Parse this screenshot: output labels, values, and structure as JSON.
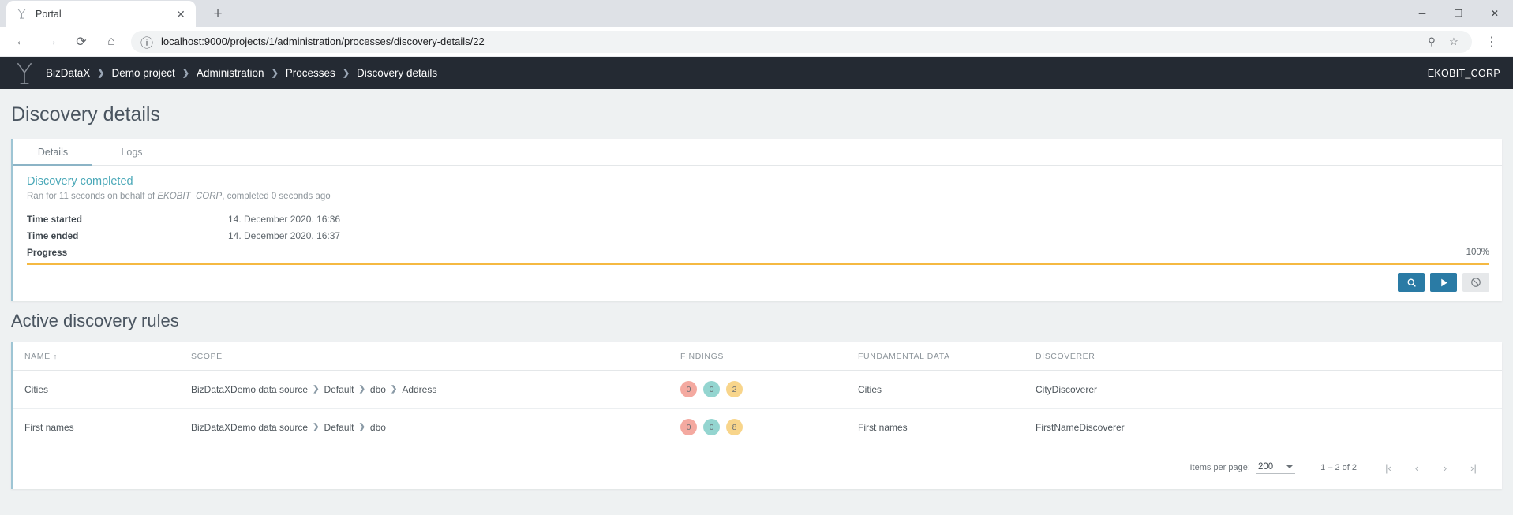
{
  "browser": {
    "tab": {
      "title": "Portal",
      "favicon": "bizdatax-logo-icon",
      "close": "✕"
    },
    "new_tab": "+",
    "window_controls": {
      "minimize": "─",
      "maximize": "❐",
      "close": "✕"
    },
    "nav": {
      "back": "←",
      "forward": "→",
      "reload": "⟳",
      "home": "⌂"
    },
    "url": "localhost:9000/projects/1/administration/processes/discovery-details/22",
    "site_info_icon": "ⓘ",
    "omnibox_search_icon": "⚲",
    "bookmark_icon": "☆",
    "menu_icon": "⋮"
  },
  "app_header": {
    "logo": "bizdatax-logo-icon",
    "breadcrumb": [
      "BizDataX",
      "Demo project",
      "Administration",
      "Processes",
      "Discovery details"
    ],
    "separator": "❯",
    "user": "EKOBIT_CORP"
  },
  "page": {
    "title": "Discovery details",
    "tabs": [
      {
        "label": "Details",
        "active": true
      },
      {
        "label": "Logs",
        "active": false
      }
    ],
    "status": {
      "title": "Discovery completed",
      "subtitle_prefix": "Ran for 11 seconds on behalf of ",
      "subtitle_actor": "EKOBIT_CORP",
      "subtitle_suffix": ", completed 0 seconds ago"
    },
    "details": [
      {
        "label": "Time started",
        "value": "14. December 2020. 16:36"
      },
      {
        "label": "Time ended",
        "value": "14. December 2020. 16:37"
      }
    ],
    "progress": {
      "label": "Progress",
      "percent": "100%",
      "value": 100
    },
    "actions": [
      {
        "name": "search-button",
        "icon": "⚲",
        "style": "primary"
      },
      {
        "name": "run-button",
        "icon": "▶",
        "style": "primary"
      },
      {
        "name": "cancel-button",
        "icon": "⊘",
        "style": "disabled"
      }
    ]
  },
  "rules_section": {
    "title": "Active discovery rules",
    "columns": [
      "NAME",
      "SCOPE",
      "FINDINGS",
      "FUNDAMENTAL DATA",
      "DISCOVERER"
    ],
    "sort_indicator": "↑",
    "rows": [
      {
        "name": "Cities",
        "scope": [
          "BizDataXDemo data source",
          "Default",
          "dbo",
          "Address"
        ],
        "findings": [
          {
            "value": "0",
            "color": "red"
          },
          {
            "value": "0",
            "color": "teal"
          },
          {
            "value": "2",
            "color": "amber"
          }
        ],
        "fundamental_data": "Cities",
        "discoverer": "CityDiscoverer"
      },
      {
        "name": "First names",
        "scope": [
          "BizDataXDemo data source",
          "Default",
          "dbo"
        ],
        "findings": [
          {
            "value": "0",
            "color": "red"
          },
          {
            "value": "0",
            "color": "teal"
          },
          {
            "value": "8",
            "color": "amber"
          }
        ],
        "fundamental_data": "First names",
        "discoverer": "FirstNameDiscoverer"
      }
    ],
    "scope_separator": "❯",
    "paginator": {
      "items_per_page_label": "Items per page:",
      "items_per_page_value": "200",
      "range": "1 – 2 of 2",
      "first": "|‹",
      "prev": "‹",
      "next": "›",
      "last": "›|"
    }
  },
  "colors": {
    "accent_teal": "#4aa8b8",
    "primary_blue": "#2a7ba5",
    "progress_amber": "#f5b942",
    "header_dark": "#242a33",
    "badge_red": "#f4a9a0",
    "badge_teal": "#94d5d0",
    "badge_amber": "#f8d58b"
  }
}
